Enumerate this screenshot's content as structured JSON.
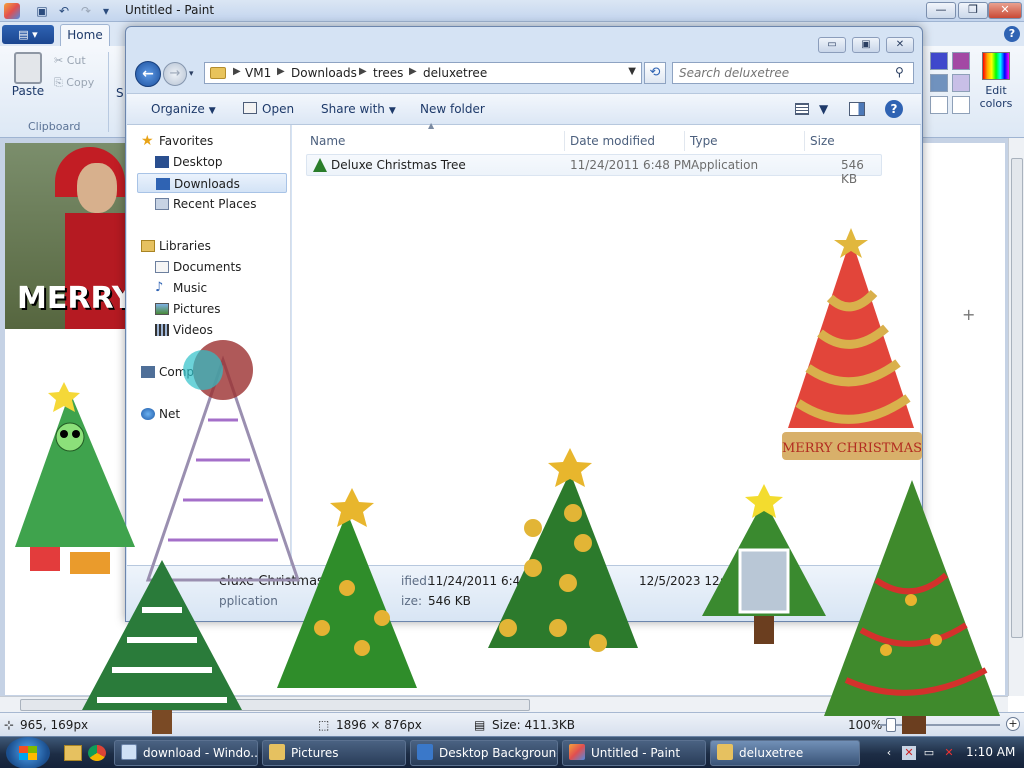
{
  "paint": {
    "title": "Untitled - Paint",
    "tabs": {
      "home": "Home"
    },
    "ribbon": {
      "paste": "Paste",
      "cut": "Cut",
      "copy": "Copy",
      "clipboard_group": "Clipboard",
      "select_partial": "S",
      "edit_colors": "Edit colors"
    },
    "canvas_text": "MERRY",
    "status": {
      "cursor": "965, 169px",
      "image_size": "1896 × 876px",
      "file_size": "Size: 411.3KB",
      "zoom": "100%"
    }
  },
  "explorer": {
    "address": {
      "crumbs": [
        "VM1",
        "Downloads",
        "trees",
        "deluxetree"
      ]
    },
    "search_placeholder": "Search deluxetree",
    "commands": {
      "organize": "Organize",
      "open": "Open",
      "share_with": "Share with",
      "new_folder": "New folder"
    },
    "nav": {
      "favorites": "Favorites",
      "desktop": "Desktop",
      "downloads": "Downloads",
      "recent": "Recent Places",
      "libraries": "Libraries",
      "documents": "Documents",
      "music": "Music",
      "pictures": "Pictures",
      "videos": "Videos",
      "computer_partial": "Comp",
      "network_partial": "Net"
    },
    "columns": {
      "name": "Name",
      "date": "Date modified",
      "type": "Type",
      "size": "Size"
    },
    "files": [
      {
        "name": "Deluxe Christmas Tree",
        "date": "11/24/2011 6:48 PM",
        "type": "Application",
        "size": "546 KB"
      }
    ],
    "details": {
      "name_partial": "eluxe Christmas",
      "type_partial": "pplication",
      "modified_label_partial": "ified:",
      "modified": "11/24/2011 6:48",
      "size_label_partial": "ize:",
      "size": "546 KB",
      "created_partial": "12/5/2023 12:54"
    }
  },
  "desktop_overlay": {
    "banner_text": "MERRY CHRISTMAS"
  },
  "taskbar": {
    "items": [
      {
        "label": "download - Windo..."
      },
      {
        "label": "Pictures"
      },
      {
        "label": "Desktop Background"
      },
      {
        "label": "Untitled - Paint"
      },
      {
        "label": "deluxetree"
      }
    ],
    "clock": "1:10 AM"
  },
  "colors": {
    "accent": "#2f63b3",
    "taskbar": "#1d2d45",
    "selection": "#d3e3f6"
  }
}
